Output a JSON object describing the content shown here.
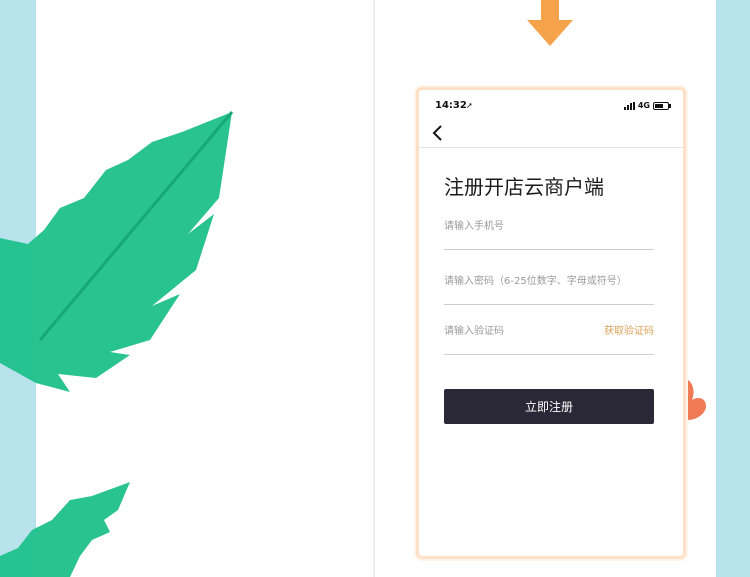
{
  "colors": {
    "side_bg": "#b8e2ec",
    "leaf_green": "#1ec08a",
    "arrow_orange": "#f5a34a",
    "petal_orange": "#f07a54",
    "button_bg": "#2a2836",
    "get_code_color": "#d9a35a",
    "phone_border": "#fde0c6"
  },
  "decor": {
    "leaf": "tropical-leaf",
    "arrow": "down-arrow-icon",
    "petal": "petal"
  },
  "status": {
    "time": "14:32",
    "location_glyph": "➚",
    "network": "4G"
  },
  "nav": {
    "back_icon": "chevron-left-icon"
  },
  "page": {
    "title": "注册开店云商户端"
  },
  "form": {
    "phone_placeholder": "请输入手机号",
    "password_placeholder": "请输入密码（6-25位数字、字母或符号）",
    "code_placeholder": "请输入验证码",
    "get_code_label": "获取验证码",
    "submit_label": "立即注册"
  }
}
